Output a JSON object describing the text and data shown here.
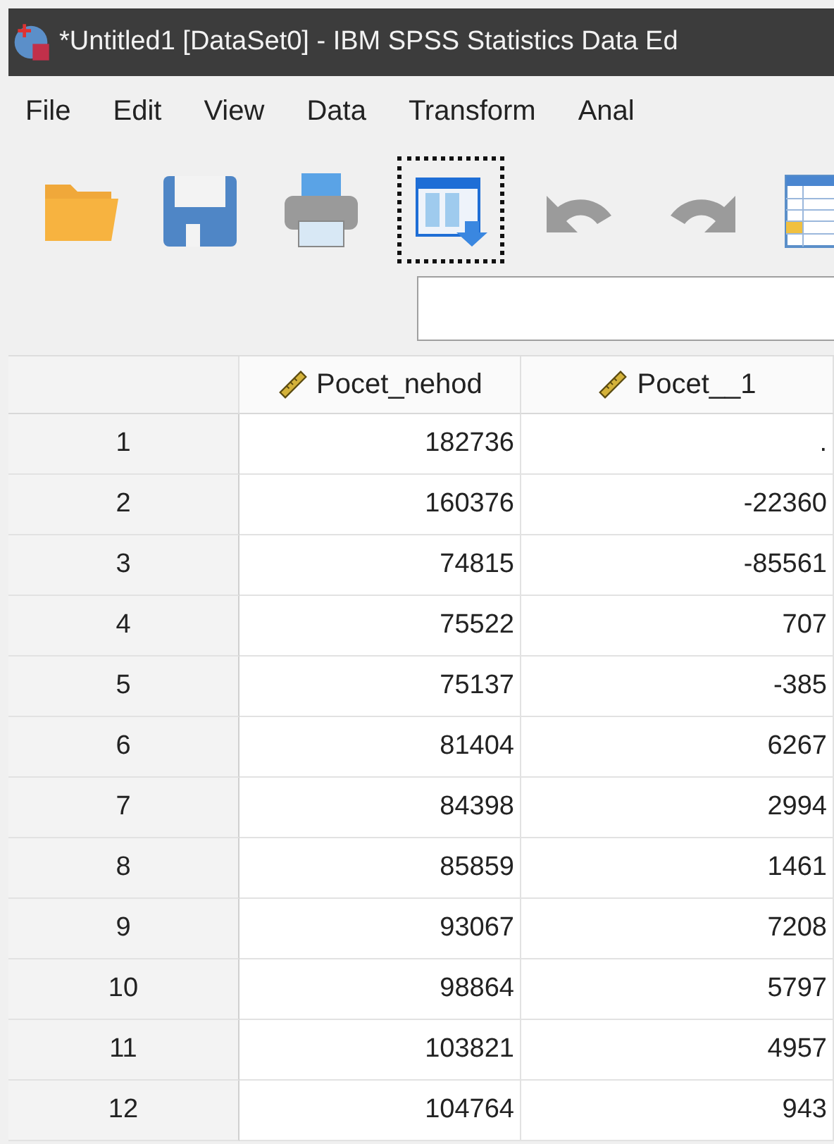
{
  "window": {
    "title": "*Untitled1 [DataSet0] - IBM SPSS Statistics Data Ed"
  },
  "menu": [
    "File",
    "Edit",
    "View",
    "Data",
    "Transform",
    "Anal"
  ],
  "toolbar": {
    "items": [
      {
        "kind": "open",
        "focused": false
      },
      {
        "kind": "save",
        "focused": false
      },
      {
        "kind": "print",
        "focused": false
      },
      {
        "kind": "recall",
        "focused": true
      },
      {
        "kind": "undo",
        "focused": false
      },
      {
        "kind": "redo",
        "focused": false
      },
      {
        "kind": "goto",
        "focused": false
      }
    ]
  },
  "table": {
    "columns": [
      "Pocet_nehod",
      "Pocet__1"
    ],
    "rows": [
      {
        "number": "1",
        "cells": [
          "182736",
          "."
        ]
      },
      {
        "number": "2",
        "cells": [
          "160376",
          "-22360"
        ]
      },
      {
        "number": "3",
        "cells": [
          "74815",
          "-85561"
        ]
      },
      {
        "number": "4",
        "cells": [
          "75522",
          "707"
        ]
      },
      {
        "number": "5",
        "cells": [
          "75137",
          "-385"
        ]
      },
      {
        "number": "6",
        "cells": [
          "81404",
          "6267"
        ]
      },
      {
        "number": "7",
        "cells": [
          "84398",
          "2994"
        ]
      },
      {
        "number": "8",
        "cells": [
          "85859",
          "1461"
        ]
      },
      {
        "number": "9",
        "cells": [
          "93067",
          "7208"
        ]
      },
      {
        "number": "10",
        "cells": [
          "98864",
          "5797"
        ]
      },
      {
        "number": "11",
        "cells": [
          "103821",
          "4957"
        ]
      },
      {
        "number": "12",
        "cells": [
          "104764",
          "943"
        ]
      }
    ]
  }
}
